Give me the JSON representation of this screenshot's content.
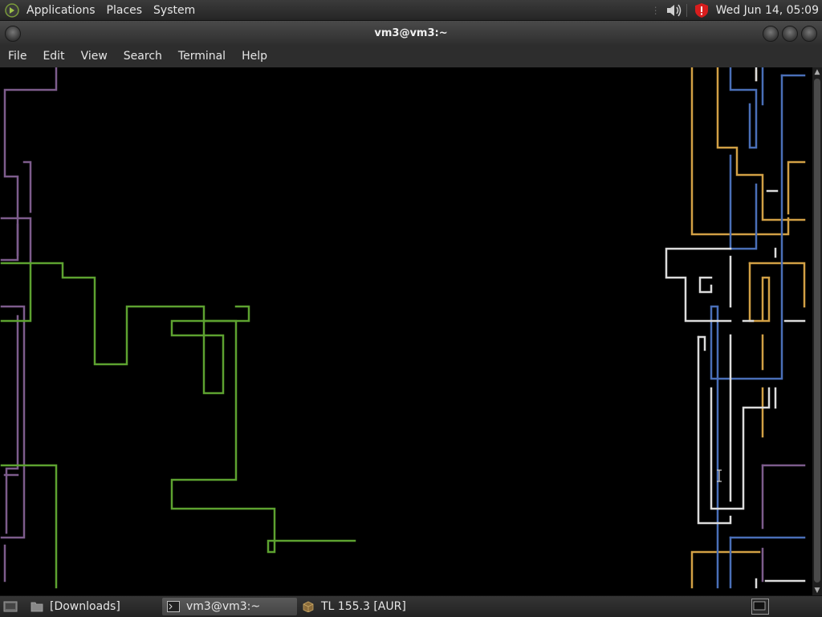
{
  "top_panel": {
    "menus": [
      "Applications",
      "Places",
      "System"
    ],
    "clock": "Wed Jun 14, 05:09",
    "tray_icons": [
      "volume-icon",
      "update-alert-icon"
    ]
  },
  "window": {
    "title": "vm3@vm3:~",
    "menubar": [
      "File",
      "Edit",
      "View",
      "Search",
      "Terminal",
      "Help"
    ]
  },
  "terminal": {
    "screensaver": "pipes",
    "colors": {
      "green": "#5da230",
      "purple": "#7d5c8c",
      "gold": "#d2a045",
      "blue": "#4a6fb8",
      "white": "#dcdcdc"
    }
  },
  "bottom_panel": {
    "tasks": [
      {
        "label": "[Downloads]",
        "icon": "folder-icon",
        "active": false
      },
      {
        "label": "vm3@vm3:~",
        "icon": "terminal-icon",
        "active": true
      },
      {
        "label": "TL 155.3 [AUR]",
        "icon": "package-icon",
        "active": false
      }
    ]
  }
}
